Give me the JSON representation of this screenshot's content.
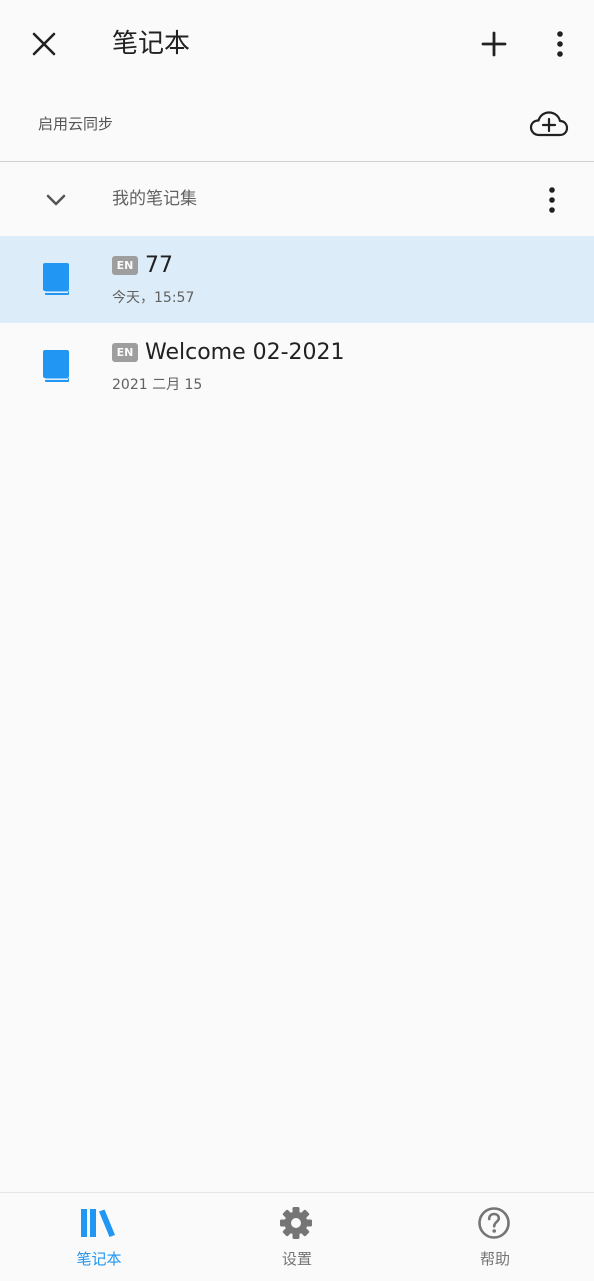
{
  "topbar": {
    "close_icon": "close-icon",
    "title": "笔记本",
    "add_icon": "plus-icon",
    "more_icon": "more-vertical-icon"
  },
  "sync": {
    "label": "启用云同步",
    "icon": "cloud-add-icon"
  },
  "group": {
    "icon": "chevron-down-icon",
    "label": "我的笔记集",
    "more_icon": "more-vertical-icon"
  },
  "notebooks": [
    {
      "icon": "notebook-icon",
      "badge": "EN",
      "title": "77",
      "date": "今天，15:57",
      "selected": true
    },
    {
      "icon": "notebook-icon",
      "badge": "EN",
      "title": "Welcome 02-2021",
      "date": "2021 二月 15",
      "selected": false
    }
  ],
  "bottom_nav": {
    "items": [
      {
        "icon": "books-icon",
        "label": "笔记本",
        "active": true
      },
      {
        "icon": "gear-icon",
        "label": "设置",
        "active": false
      },
      {
        "icon": "help-circle-icon",
        "label": "帮助",
        "active": false
      }
    ]
  },
  "colors": {
    "accent": "#2196f3",
    "selected_background": "#dcecf8",
    "badge": "#9e9e9e",
    "background": "#fafafa"
  }
}
